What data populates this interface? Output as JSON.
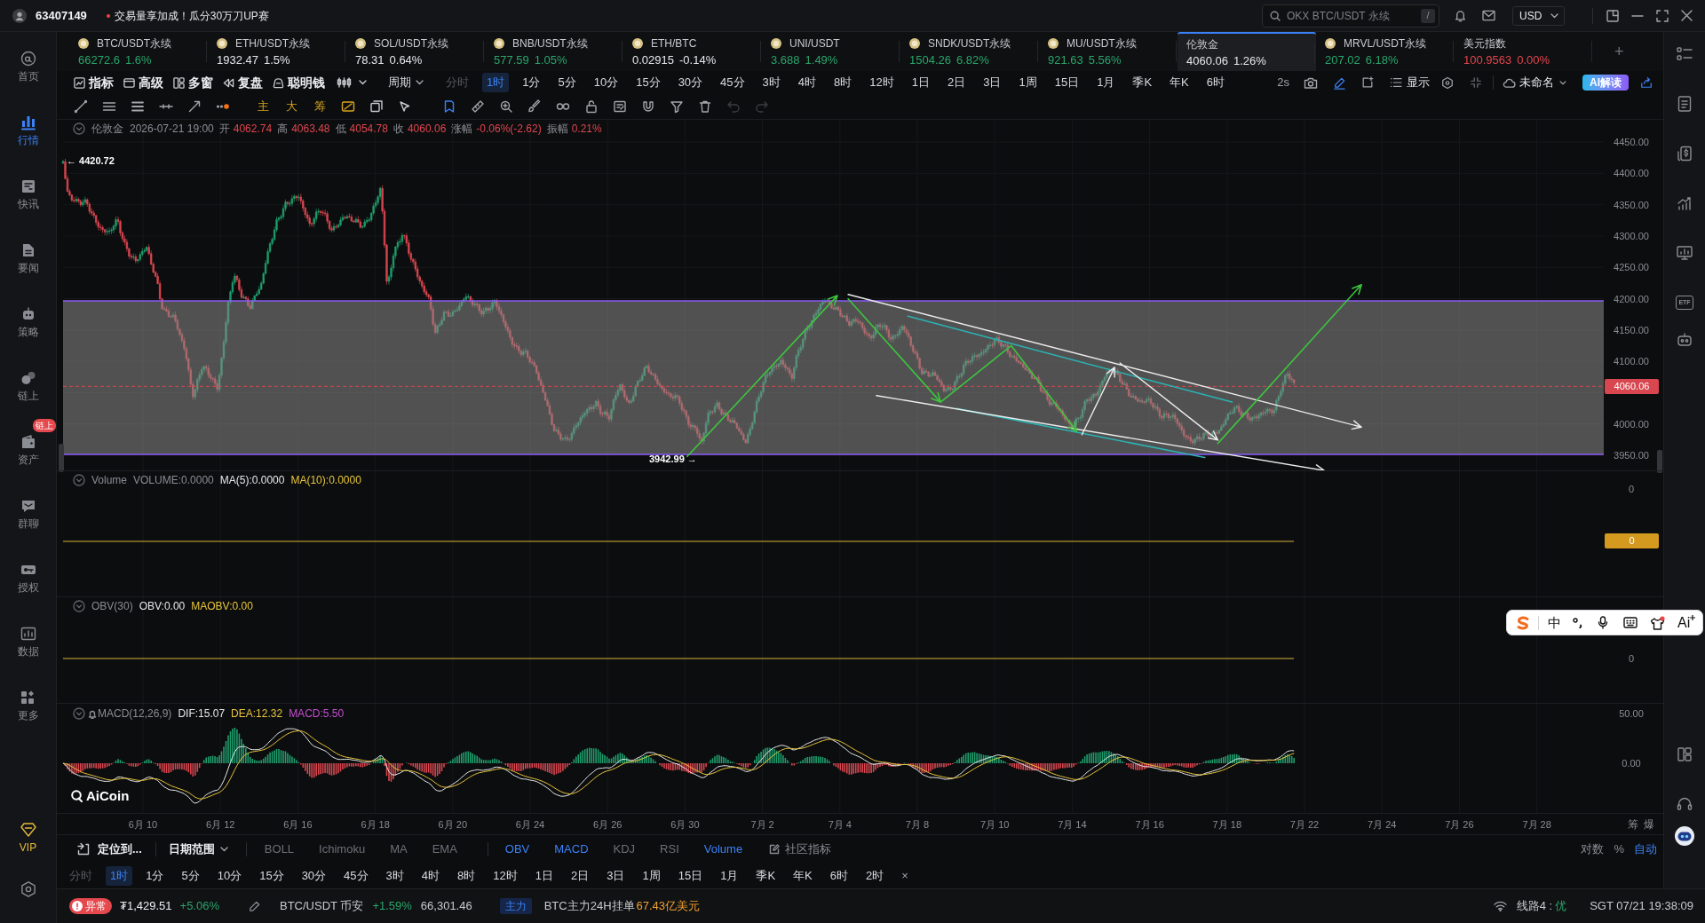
{
  "header": {
    "user_id": "63407149",
    "promo": "交易量享加成！瓜分30万刀UP赛",
    "search": {
      "placeholder": "OKX BTC/USDT 永续",
      "shortcut": "/"
    },
    "currency": "USD"
  },
  "sidebar": {
    "items": [
      {
        "label": "首页",
        "selected": false
      },
      {
        "label": "行情",
        "selected": true
      },
      {
        "label": "快讯",
        "selected": false
      },
      {
        "label": "要闻",
        "selected": false
      },
      {
        "label": "策略",
        "selected": false
      },
      {
        "label": "链上",
        "selected": false
      },
      {
        "label": "资产",
        "selected": false,
        "badge": "链上"
      },
      {
        "label": "群聊",
        "selected": false
      },
      {
        "label": "授权",
        "selected": false
      },
      {
        "label": "数据",
        "selected": false
      },
      {
        "label": "更多",
        "selected": false
      }
    ],
    "vip": "VIP"
  },
  "ticker_bar": {
    "tickers": [
      {
        "kind": "coin",
        "symbol": "BTC/USDT永续",
        "price": "66272.6",
        "change": "1.6%",
        "color": "#2aa56b",
        "selected": false
      },
      {
        "kind": "coin",
        "symbol": "ETH/USDT永续",
        "price": "1932.47",
        "change": "1.5%",
        "color": "#e6e7ea",
        "selected": false
      },
      {
        "kind": "coin",
        "symbol": "SOL/USDT永续",
        "price": "78.31",
        "change": "0.64%",
        "color": "#e6e7ea",
        "selected": false
      },
      {
        "kind": "coin",
        "symbol": "BNB/USDT永续",
        "price": "577.59",
        "change": "1.05%",
        "color": "#2aa56b",
        "selected": false
      },
      {
        "kind": "coin",
        "symbol": "ETH/BTC",
        "price": "0.02915",
        "change": "-0.14%",
        "color": "#e6e7ea",
        "selected": false
      },
      {
        "kind": "coin",
        "symbol": "UNI/USDT",
        "price": "3.688",
        "change": "1.49%",
        "color": "#2aa56b",
        "selected": false
      },
      {
        "kind": "coin",
        "symbol": "SNDK/USDT永续",
        "price": "1504.26",
        "change": "6.82%",
        "color": "#2aa56b",
        "selected": false
      },
      {
        "kind": "coin",
        "symbol": "MU/USDT永续",
        "price": "921.63",
        "change": "5.56%",
        "color": "#2aa56b",
        "selected": false
      },
      {
        "kind": "index",
        "symbol": "伦敦金",
        "price": "4060.06",
        "change": "1.26%",
        "color": "#e6e7ea",
        "selected": true
      },
      {
        "kind": "coin",
        "symbol": "MRVL/USDT永续",
        "price": "207.02",
        "change": "6.18%",
        "color": "#2aa56b",
        "selected": false
      },
      {
        "kind": "index",
        "symbol": "美元指数",
        "price": "100.9563",
        "change": "0.00%",
        "color": "#e0464e",
        "selected": false
      }
    ],
    "add": "+"
  },
  "toolbar": {
    "tools": [
      "指标",
      "高级",
      "多窗",
      "复盘",
      "聪明钱"
    ],
    "period_menu": "周期",
    "periods": [
      {
        "label": "分时",
        "selected": false,
        "disabled": true
      },
      {
        "label": "1时",
        "selected": true,
        "disabled": false
      },
      {
        "label": "1分",
        "selected": false,
        "disabled": false
      },
      {
        "label": "5分",
        "selected": false,
        "disabled": false
      },
      {
        "label": "10分",
        "selected": false,
        "disabled": false
      },
      {
        "label": "15分",
        "selected": false,
        "disabled": false
      },
      {
        "label": "30分",
        "selected": false,
        "disabled": false
      },
      {
        "label": "45分",
        "selected": false,
        "disabled": false
      },
      {
        "label": "3时",
        "selected": false,
        "disabled": false
      },
      {
        "label": "4时",
        "selected": false,
        "disabled": false
      },
      {
        "label": "8时",
        "selected": false,
        "disabled": false
      },
      {
        "label": "12时",
        "selected": false,
        "disabled": false
      },
      {
        "label": "1日",
        "selected": false,
        "disabled": false
      },
      {
        "label": "2日",
        "selected": false,
        "disabled": false
      },
      {
        "label": "3日",
        "selected": false,
        "disabled": false
      },
      {
        "label": "1周",
        "selected": false,
        "disabled": false
      },
      {
        "label": "15日",
        "selected": false,
        "disabled": false
      },
      {
        "label": "1月",
        "selected": false,
        "disabled": false
      },
      {
        "label": "季K",
        "selected": false,
        "disabled": false
      },
      {
        "label": "年K",
        "selected": false,
        "disabled": false
      },
      {
        "label": "6时",
        "selected": false,
        "disabled": false
      }
    ],
    "refresh": "2s",
    "draw_mode": {
      "on": true
    },
    "display": "显示",
    "layout_name": "未命名",
    "ai_button": "AI解读"
  },
  "drawing_bar": {
    "text_tools": [
      "主",
      "大",
      "筹"
    ],
    "active_tool": {
      "on": true
    },
    "undo": {
      "disabled": true
    },
    "redo": {
      "disabled": true
    }
  },
  "chart": {
    "info": {
      "symbol": "伦敦金",
      "time": "2026-07-21 19:00",
      "fields": [
        {
          "label": "开",
          "value": "4062.74"
        },
        {
          "label": "高",
          "value": "4063.48"
        },
        {
          "label": "低",
          "value": "4054.78"
        },
        {
          "label": "收",
          "value": "4060.06"
        },
        {
          "label": "涨幅",
          "value": "-0.06%(-2.62)"
        },
        {
          "label": "振幅",
          "value": "0.21%"
        }
      ]
    },
    "price_axis": [
      "4450.00",
      "4400.00",
      "4350.00",
      "4300.00",
      "4250.00",
      "4200.00",
      "4150.00",
      "4100.00",
      "4000.00",
      "3950.00"
    ],
    "last_price": "4060.06",
    "high_marker": "← 4420.72",
    "low_marker": "3942.99 →",
    "panes": [
      {
        "kind": "volume",
        "legend": [
          {
            "text": "Volume",
            "color": "#8a8d93"
          },
          {
            "text": "VOLUME:0.0000",
            "color": "#8a8d93"
          },
          {
            "text": "MA(5):0.0000",
            "color": "#e6e7ea"
          },
          {
            "text": "MA(10):0.0000",
            "color": "#e8c53a"
          }
        ],
        "axis": [
          "0"
        ],
        "tag": "0"
      },
      {
        "kind": "obv",
        "legend": [
          {
            "text": "OBV(30)",
            "color": "#8a8d93"
          },
          {
            "text": "OBV:0.00",
            "color": "#e6e7ea"
          },
          {
            "text": "MAOBV:0.00",
            "color": "#e8c53a"
          }
        ],
        "axis": [
          "0"
        ]
      },
      {
        "kind": "macd",
        "legend": [
          {
            "text": "MACD(12,26,9)",
            "color": "#8a8d93"
          },
          {
            "text": "DIF:15.07",
            "color": "#e6e7ea"
          },
          {
            "text": "DEA:12.32",
            "color": "#e8c53a"
          },
          {
            "text": "MACD:5.50",
            "color": "#c44fcf"
          }
        ],
        "axis": [
          "50.00",
          "0.00"
        ]
      }
    ],
    "time_axis": [
      "6月 10",
      "6月 12",
      "6月 16",
      "6月 18",
      "6月 20",
      "6月 24",
      "6月 26",
      "6月 30",
      "7月 2",
      "7月 4",
      "7月 8",
      "7月 10",
      "7月 14",
      "7月 16",
      "7月 18",
      "7月 22",
      "7月 24",
      "7月 26",
      "7月 28"
    ],
    "axis_buttons": [
      "筹",
      "爆"
    ],
    "logo": "AiCoin"
  },
  "indicator_bar": {
    "locate": "定位到...",
    "date_range": "日期范围",
    "main_indicators": [
      {
        "label": "BOLL",
        "selected": false
      },
      {
        "label": "Ichimoku",
        "selected": false
      },
      {
        "label": "MA",
        "selected": false
      },
      {
        "label": "EMA",
        "selected": false
      }
    ],
    "sub_indicators": [
      {
        "label": "OBV",
        "selected": true
      },
      {
        "label": "MACD",
        "selected": true
      },
      {
        "label": "KDJ",
        "selected": false
      },
      {
        "label": "RSI",
        "selected": false
      },
      {
        "label": "Volume",
        "selected": true
      }
    ],
    "community": "社区指标",
    "scale_options": [
      {
        "label": "对数",
        "selected": false
      },
      {
        "label": "%",
        "selected": false
      },
      {
        "label": "自动",
        "selected": true
      }
    ]
  },
  "period_bar": {
    "periods": [
      {
        "label": "分时",
        "selected": false,
        "disabled": true
      },
      {
        "label": "1时",
        "selected": true,
        "disabled": false
      },
      {
        "label": "1分",
        "selected": false,
        "disabled": false
      },
      {
        "label": "5分",
        "selected": false,
        "disabled": false
      },
      {
        "label": "10分",
        "selected": false,
        "disabled": false
      },
      {
        "label": "15分",
        "selected": false,
        "disabled": false
      },
      {
        "label": "30分",
        "selected": false,
        "disabled": false
      },
      {
        "label": "45分",
        "selected": false,
        "disabled": false
      },
      {
        "label": "3时",
        "selected": false,
        "disabled": false
      },
      {
        "label": "4时",
        "selected": false,
        "disabled": false
      },
      {
        "label": "8时",
        "selected": false,
        "disabled": false
      },
      {
        "label": "12时",
        "selected": false,
        "disabled": false
      },
      {
        "label": "1日",
        "selected": false,
        "disabled": false
      },
      {
        "label": "2日",
        "selected": false,
        "disabled": false
      },
      {
        "label": "3日",
        "selected": false,
        "disabled": false
      },
      {
        "label": "1周",
        "selected": false,
        "disabled": false
      },
      {
        "label": "15日",
        "selected": false,
        "disabled": false
      },
      {
        "label": "1月",
        "selected": false,
        "disabled": false
      },
      {
        "label": "季K",
        "selected": false,
        "disabled": false
      },
      {
        "label": "年K",
        "selected": false,
        "disabled": false
      },
      {
        "label": "6时",
        "selected": false,
        "disabled": false
      },
      {
        "label": "2时",
        "selected": false,
        "disabled": false
      }
    ],
    "close": "×"
  },
  "right_sidebar": {
    "etf_label": "ETF"
  },
  "ime_toolbar": {
    "mode": "中",
    "ai": "Ai"
  },
  "status_bar": {
    "alert": "异常",
    "alert_price": "₮1,429.51",
    "alert_change": "+5.06%",
    "pair": "BTC/USDT 币安",
    "pair_change": "+1.59%",
    "pair_price": "66,301.46",
    "tag": "主力",
    "order_label": "BTC主力24H挂单",
    "order_value": "67.43亿美元",
    "line": "线路4 :",
    "line_quality": "优",
    "clock": "SGT 07/21 19:38:09"
  }
}
